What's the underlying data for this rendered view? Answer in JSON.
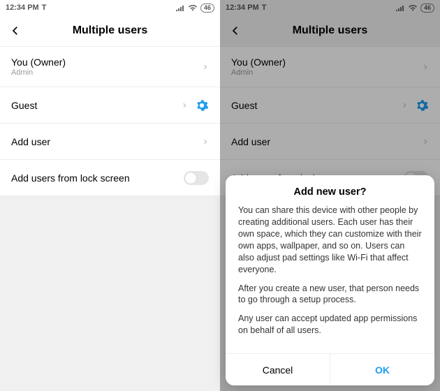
{
  "status": {
    "time": "12:34 PM",
    "carrier_glyph": "T",
    "battery": "46"
  },
  "header": {
    "title": "Multiple users"
  },
  "rows": {
    "owner": {
      "title": "You (Owner)",
      "sub": "Admin"
    },
    "guest": {
      "title": "Guest"
    },
    "add": {
      "title": "Add user"
    },
    "lock": {
      "title": "Add users from lock screen"
    }
  },
  "dialog": {
    "title": "Add new user?",
    "p1": "You can share this device with other people by creating additional users. Each user has their own space, which they can customize with their own apps, wallpaper, and so on. Users can also adjust pad settings like Wi-Fi that affect everyone.",
    "p2": "After you create a new user, that person needs to go through a setup process.",
    "p3": "Any user can accept updated app permissions on behalf of all users.",
    "cancel": "Cancel",
    "ok": "OK"
  },
  "colors": {
    "gear": "#1e9df0"
  }
}
